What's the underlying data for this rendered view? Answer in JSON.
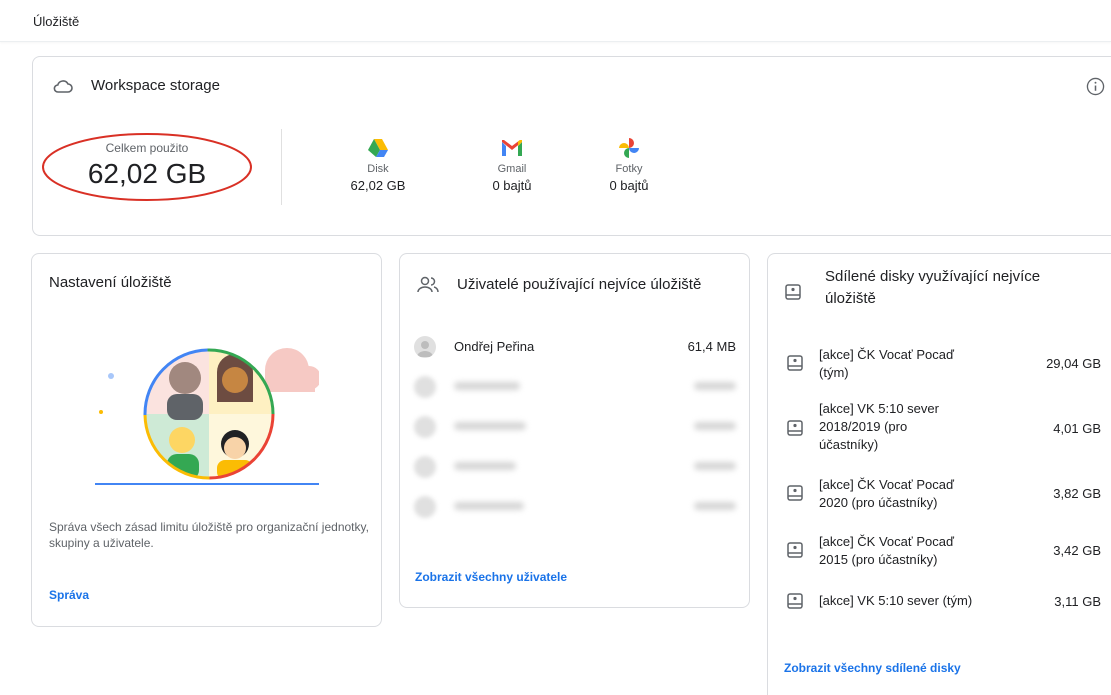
{
  "page": {
    "title": "Úložiště"
  },
  "storage": {
    "title": "Workspace storage",
    "total_label": "Celkem použito",
    "total_value": "62,02 GB",
    "services": [
      {
        "name": "Disk",
        "value": "62,02 GB",
        "icon": "google-drive-icon"
      },
      {
        "name": "Gmail",
        "value": "0 bajtů",
        "icon": "gmail-icon"
      },
      {
        "name": "Fotky",
        "value": "0 bajtů",
        "icon": "google-photos-icon"
      }
    ]
  },
  "settings": {
    "title": "Nastavení úložiště",
    "description": "Správa všech zásad limitu úložiště pro organizační jednotky, skupiny a uživatele.",
    "link": "Správa"
  },
  "users": {
    "title": "Uživatelé používající nejvíce úložiště",
    "rows": [
      {
        "name": "Ondřej Peřina",
        "size": "61,4 MB"
      }
    ],
    "link": "Zobrazit všechny uživatele"
  },
  "drives": {
    "title_line1": "Sdílené disky využívající nejvíce",
    "title_line2": "úložiště",
    "items": [
      {
        "lines": [
          "[akce] ČK Vocať Pocaď",
          "(tým)"
        ],
        "size": "29,04 GB"
      },
      {
        "lines": [
          "[akce] VK 5:10 sever",
          "2018/2019 (pro",
          "účastníky)"
        ],
        "size": "4,01 GB"
      },
      {
        "lines": [
          "[akce] ČK Vocať Pocaď",
          "2020 (pro účastníky)"
        ],
        "size": "3,82 GB"
      },
      {
        "lines": [
          "[akce] ČK Vocať Pocaď",
          "2015 (pro účastníky)"
        ],
        "size": "3,42 GB"
      },
      {
        "lines": [
          "[akce] VK 5:10 sever (tým)"
        ],
        "size": "3,11 GB"
      }
    ],
    "link": "Zobrazit všechny sdílené disky"
  },
  "colors": {
    "link": "#1a73e8",
    "annotation": "#d93025"
  }
}
